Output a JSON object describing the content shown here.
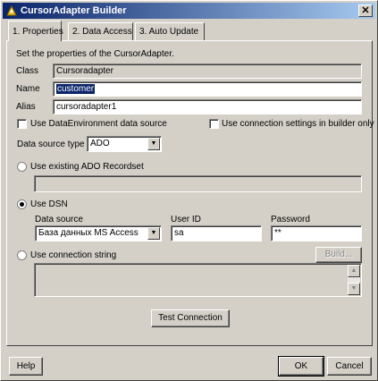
{
  "window": {
    "title": "CursorAdapter Builder",
    "close_glyph": "✕"
  },
  "tabs": [
    {
      "label": "1. Properties"
    },
    {
      "label": "2. Data Access"
    },
    {
      "label": "3. Auto Update"
    }
  ],
  "properties": {
    "intro": "Set the properties of the CursorAdapter.",
    "class_label": "Class",
    "class_value": "Cursoradapter",
    "name_label": "Name",
    "name_value": "customer",
    "alias_label": "Alias",
    "alias_value": "cursoradapter1",
    "use_dataenv_label": "Use DataEnvironment data source",
    "use_conn_settings_label": "Use connection settings in builder only",
    "datasource_type_label": "Data source type",
    "datasource_type_value": "ADO",
    "use_existing_label": "Use existing ADO Recordset",
    "use_dsn_label": "Use DSN",
    "data_source_label": "Data source",
    "data_source_value": "База данных MS Access",
    "user_id_label": "User ID",
    "user_id_value": "sa",
    "password_label": "Password",
    "password_value": "**",
    "use_conn_string_label": "Use connection string",
    "build_label": "Build...",
    "test_connection_label": "Test Connection"
  },
  "footer": {
    "help_label": "Help",
    "ok_label": "OK",
    "cancel_label": "Cancel"
  }
}
